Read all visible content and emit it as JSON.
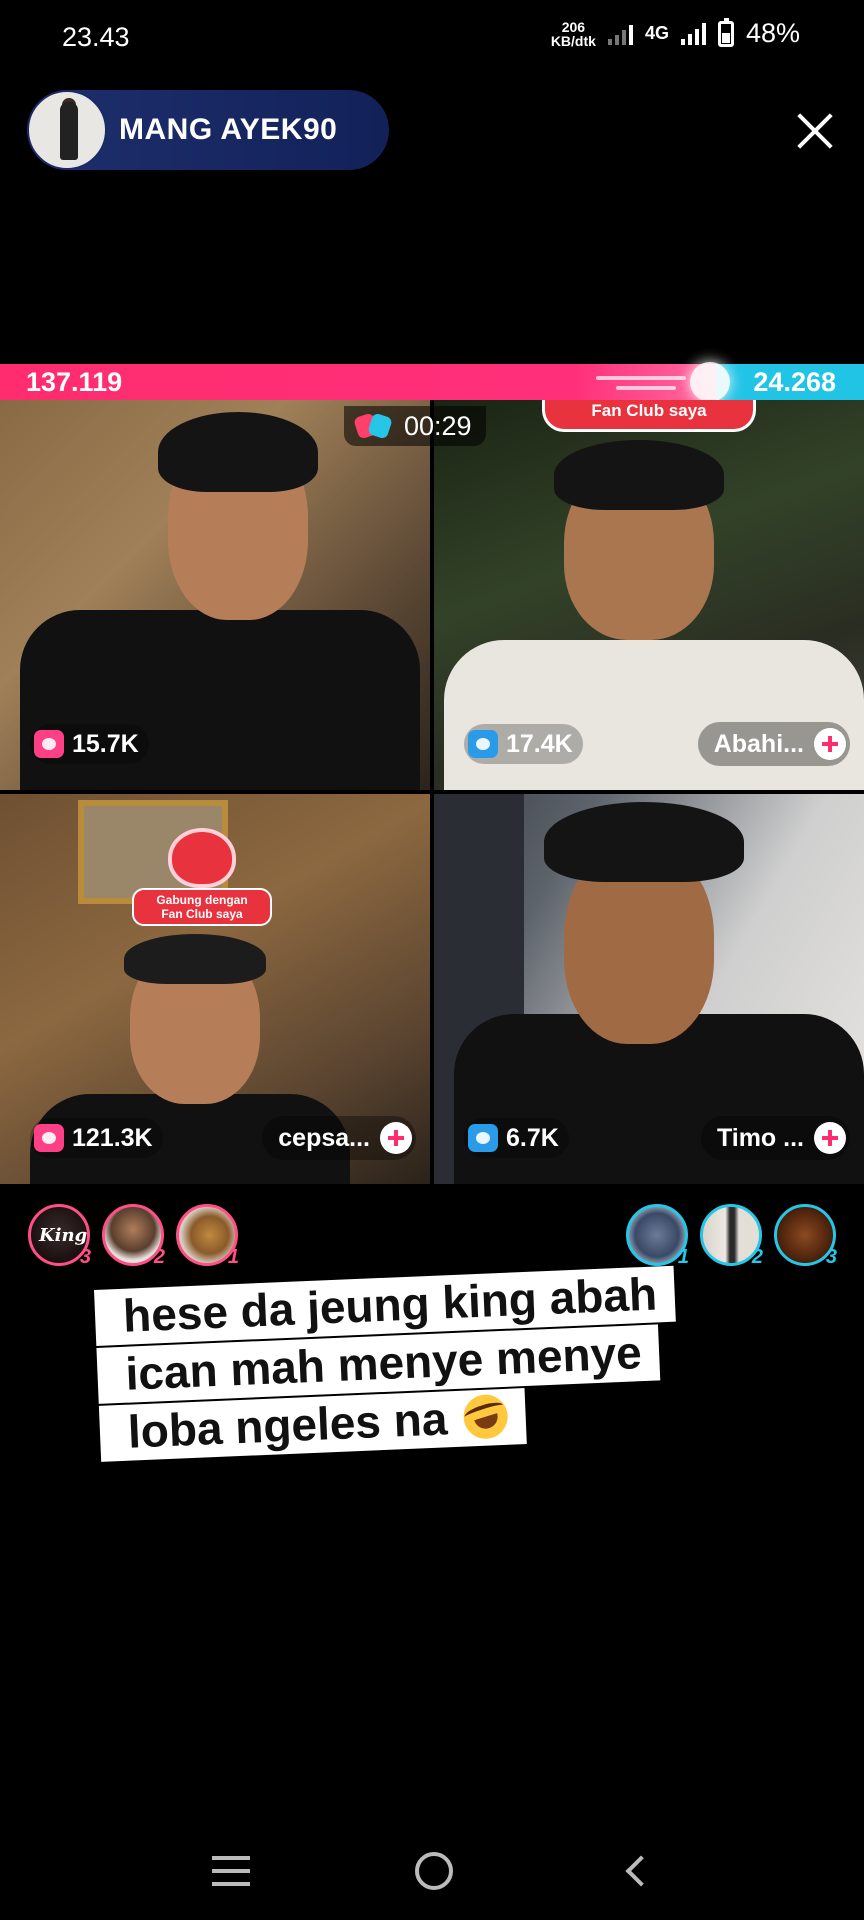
{
  "status_bar": {
    "time": "23.43",
    "speed_value": "206",
    "speed_unit": "KB/dtk",
    "network": "4G",
    "battery": "48%"
  },
  "host": {
    "name": "MANG AYEK90"
  },
  "battle": {
    "score_left": "137.119",
    "score_right": "24.268",
    "timer": "00:29"
  },
  "participants": [
    {
      "count": "15.7K",
      "team": "pink",
      "name": ""
    },
    {
      "count": "17.4K",
      "team": "blue",
      "name": "Abahi...",
      "badge": "Fan Club saya"
    },
    {
      "count": "121.3K",
      "team": "pink",
      "name": "cepsa...",
      "overlay_line1": "Gabung dengan",
      "overlay_line2": "Fan Club saya"
    },
    {
      "count": "6.7K",
      "team": "blue",
      "name": "Timo ..."
    }
  ],
  "gifters_left": [
    {
      "rank": "3",
      "label": "King"
    },
    {
      "rank": "2"
    },
    {
      "rank": "1"
    }
  ],
  "gifters_right": [
    {
      "rank": "1"
    },
    {
      "rank": "2"
    },
    {
      "rank": "3"
    }
  ],
  "caption": {
    "line1": "hese da jeung king abah",
    "line2": "ican mah menye menye",
    "line3": "loba ngeles na"
  },
  "colors": {
    "team_pink": "#ff2d6f",
    "team_blue": "#22c4e6",
    "host_pill": "#1f2f6e"
  }
}
